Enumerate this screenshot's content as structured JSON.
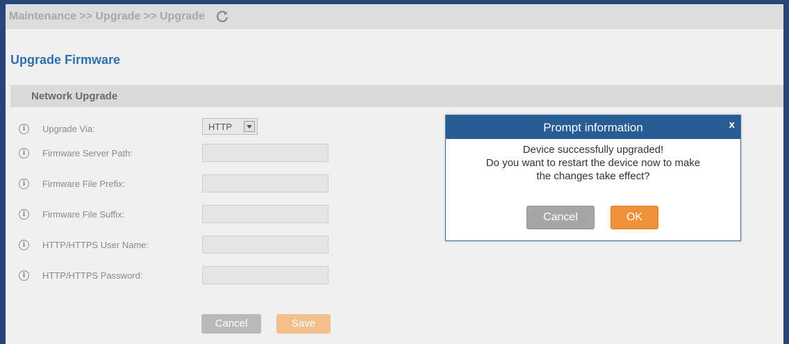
{
  "breadcrumb": "Maintenance >> Upgrade >> Upgrade",
  "page_title": "Upgrade Firmware",
  "section_title": "Network Upgrade",
  "fields": [
    {
      "label": "Upgrade Via:",
      "value": "HTTP"
    },
    {
      "label": "Firmware Server Path:",
      "value": ""
    },
    {
      "label": "Firmware File Prefix:",
      "value": ""
    },
    {
      "label": "Firmware File Suffix:",
      "value": ""
    },
    {
      "label": "HTTP/HTTPS User Name:",
      "value": ""
    },
    {
      "label": "HTTP/HTTPS Password:",
      "value": ""
    }
  ],
  "buttons": {
    "cancel": "Cancel",
    "save": "Save"
  },
  "modal": {
    "title": "Prompt information",
    "close": "x",
    "message_lines": [
      "Device successfully upgraded!",
      "Do you want to restart the device now to make",
      "the changes take effect?"
    ],
    "cancel": "Cancel",
    "ok": "OK"
  },
  "icons": {
    "refresh": "refresh-icon",
    "info": "info-icon",
    "dropdown": "chevron-down-icon"
  },
  "colors": {
    "header_blue": "#275c95",
    "title_blue": "#2f6fb0",
    "ok_orange": "#f0913a",
    "save_orange": "#f2c08a"
  }
}
